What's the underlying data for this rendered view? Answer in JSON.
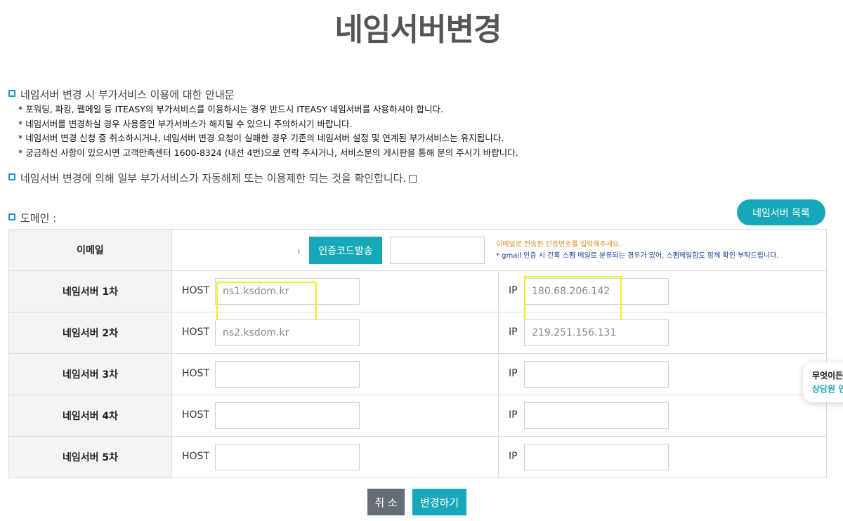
{
  "page": {
    "title": "네임서버변경"
  },
  "notice": {
    "heading": "네임서버 변경 시 부가서비스 이용에 대한 안내문",
    "items": [
      "* 포워딩, 파킹, 웹메일 등 ITEASY의 부가서비스를 이용하시는 경우 반드시 ITEASY 네임서버를 사용하셔야 합니다.",
      "* 네임서버를 변경하실 경우 사용중인 부가서비스가 해지될 수 있으니 주의하시기 바랍니다.",
      "* 네임서버 변경 신청 중 취소하시거나, 네임서버 변경 요청이 실패한 경우 기존의 네임서버 설정 및 연계된 부가서비스는 유지됩니다.",
      "* 궁금하신 사항이 있으시면 고객만족센터 1600-8324 (내선 4번)으로 연락 주시거나, 서비스문의 게시판을 통해 문의 주시기 바랍니다."
    ]
  },
  "confirm": {
    "text": "네임서버 변경에 의해 일부 부가서비스가 자동해제 또는 이용제한 되는 것을 확인합니다.",
    "checked": false
  },
  "domain": {
    "label": "도메인 :"
  },
  "buttons": {
    "ns_list": "네임서버 목록",
    "send_code": "인증코드발송",
    "cancel": "취 소",
    "submit": "변경하기"
  },
  "email_row": {
    "label": "이메일",
    "value": "ı",
    "note_orange": "이메일로 전송된 인증번호를 입력해주세요.",
    "note_blue": "* gmail 인증 시 간혹 스팸 메일로 분류되는 경우가 있어, 스팸메일함도 함께 확인 부탁드립니다."
  },
  "field_labels": {
    "host": "HOST",
    "ip": "IP"
  },
  "nameservers": [
    {
      "label": "네임서버 1차",
      "host": "ns1.ksdom.kr",
      "ip": "180.68.206.142"
    },
    {
      "label": "네임서버 2차",
      "host": "ns2.ksdom.kr",
      "ip": "219.251.156.131"
    },
    {
      "label": "네임서버 3차",
      "host": "",
      "ip": ""
    },
    {
      "label": "네임서버 4차",
      "host": "",
      "ip": ""
    },
    {
      "label": "네임서버 5차",
      "host": "",
      "ip": ""
    }
  ],
  "chat_widget": {
    "line1": "무엇이든",
    "line2": "상담원 연"
  },
  "colors": {
    "accent": "#16a8b8",
    "cancel": "#656d75",
    "highlight": "#f0ee1e",
    "note_orange": "#e08b1e",
    "note_blue": "#1b3e9a"
  }
}
